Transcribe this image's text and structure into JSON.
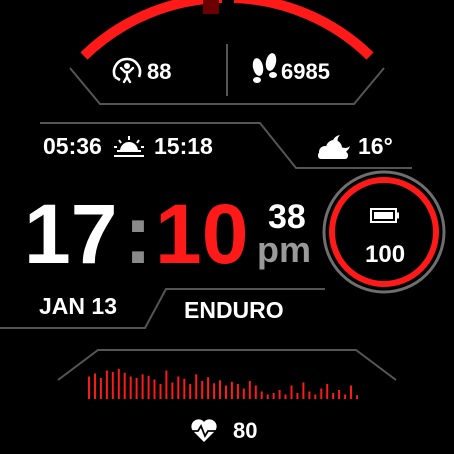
{
  "colors": {
    "accent": "#ff1a1a",
    "text": "#ffffff",
    "muted": "#9a9a9a",
    "line": "#555555",
    "background": "#000000"
  },
  "top": {
    "body_battery": "88",
    "body_battery_icon": "body-battery-icon",
    "steps": "6985",
    "steps_icon": "footsteps-icon",
    "arc_progress": 0.95
  },
  "sun": {
    "sunrise": "05:36",
    "sunset": "15:18",
    "icon": "sunrise-icon"
  },
  "weather": {
    "temperature": "16°",
    "icon": "partly-cloudy-night-icon"
  },
  "time": {
    "hour": "17",
    "separator": ":",
    "minute": "10",
    "seconds": "38",
    "ampm": "pm"
  },
  "battery": {
    "percent": "100",
    "icon": "battery-icon",
    "level": 1.0
  },
  "date": "JAN 13",
  "mode": "ENDURO",
  "heart_rate": {
    "value": "80",
    "icon": "heart-rate-icon",
    "history": [
      30,
      34,
      28,
      38,
      36,
      40,
      35,
      30,
      28,
      33,
      31,
      26,
      20,
      38,
      22,
      30,
      27,
      20,
      33,
      24,
      29,
      21,
      25,
      18,
      23,
      20,
      14,
      24,
      18,
      10,
      6,
      8,
      12,
      6,
      18,
      8,
      22,
      10,
      6,
      14,
      20,
      8,
      12,
      6,
      18,
      5
    ]
  }
}
